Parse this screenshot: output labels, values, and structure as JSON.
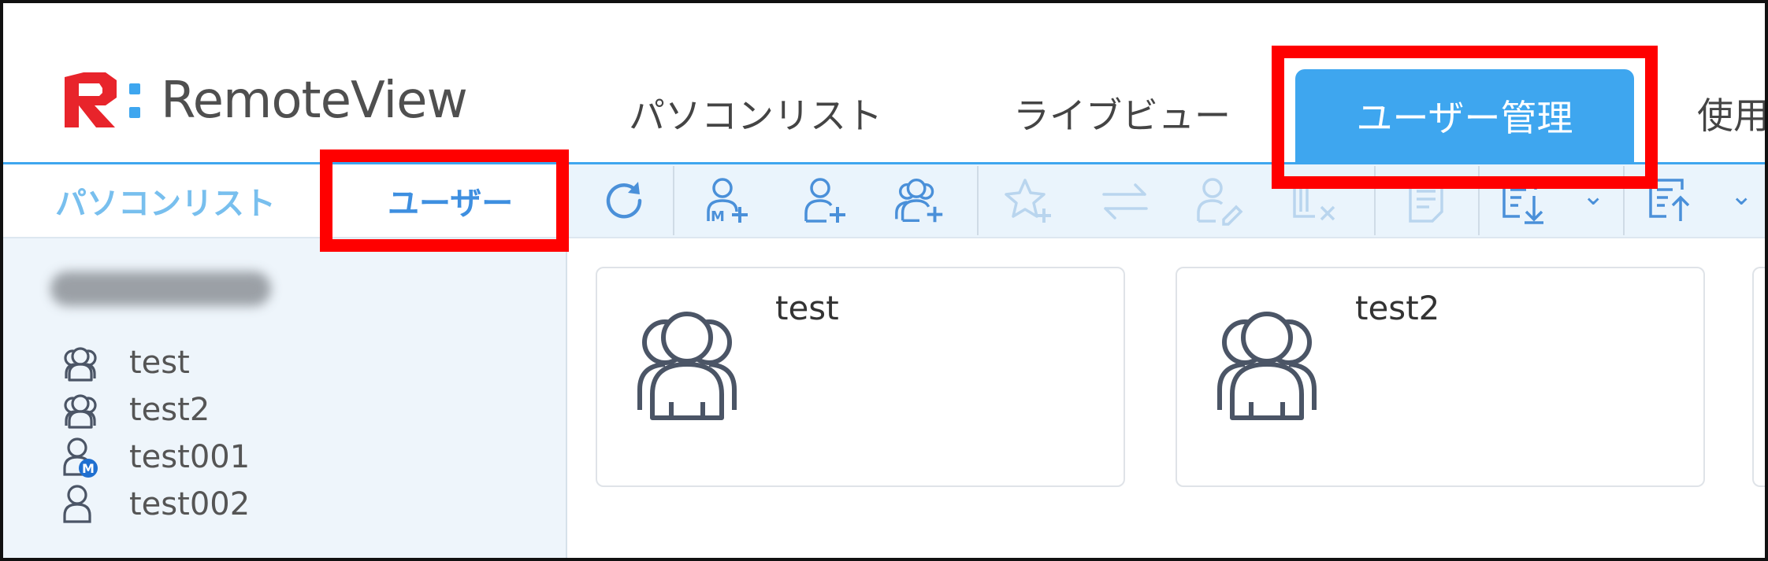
{
  "header": {
    "logo_text": "RemoteView",
    "tabs": [
      {
        "label": "パソコンリスト",
        "active": false
      },
      {
        "label": "ライブビュー",
        "active": false
      },
      {
        "label": "ユーザー管理",
        "active": true
      },
      {
        "label": "使用",
        "active": false
      }
    ]
  },
  "sidebar": {
    "tabs": [
      {
        "label": "パソコンリスト",
        "active": false
      },
      {
        "label": "ユーザー",
        "active": true
      }
    ],
    "users": [
      {
        "label": "test",
        "icon": "user-group-icon"
      },
      {
        "label": "test2",
        "icon": "user-group-icon"
      },
      {
        "label": "test001",
        "icon": "user-manager-icon"
      },
      {
        "label": "test002",
        "icon": "user-icon"
      }
    ]
  },
  "toolbar": {
    "buttons": [
      {
        "name": "refresh-icon",
        "enabled": true
      },
      {
        "name": "add-manager-icon",
        "enabled": true
      },
      {
        "name": "add-user-icon",
        "enabled": true
      },
      {
        "name": "add-group-icon",
        "enabled": true
      },
      {
        "name": "favorite-add-icon",
        "enabled": false
      },
      {
        "name": "transfer-icon",
        "enabled": false
      },
      {
        "name": "user-edit-icon",
        "enabled": false
      },
      {
        "name": "remove-icon",
        "enabled": false
      },
      {
        "name": "notes-icon",
        "enabled": false
      },
      {
        "name": "import-icon",
        "enabled": true
      },
      {
        "name": "export-icon",
        "enabled": true
      }
    ]
  },
  "cards": [
    {
      "name": "test",
      "icon": "user-group-icon"
    },
    {
      "name": "test2",
      "icon": "user-group-icon"
    }
  ],
  "colors": {
    "accent": "#3ea6ef",
    "highlight": "#ff0000",
    "sidebar_bg": "#eef5fb",
    "toolbar_bg": "#eaf4fc"
  }
}
